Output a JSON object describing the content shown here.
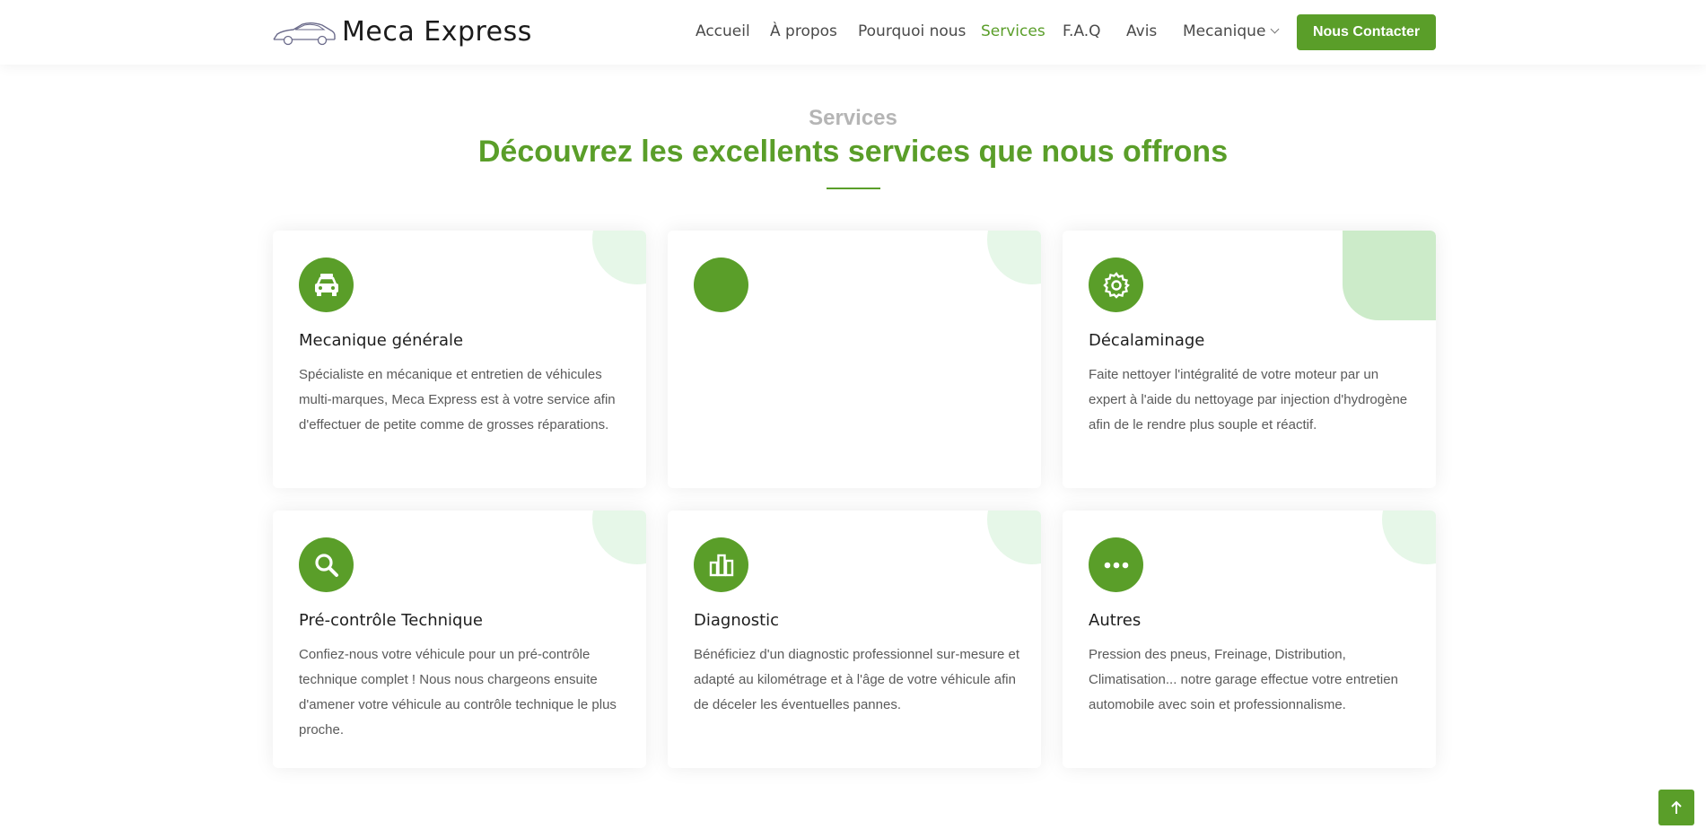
{
  "header": {
    "brand": "Meca Express",
    "logo_icon": "car-outline-icon",
    "nav": [
      {
        "label": "Accueil",
        "active": false
      },
      {
        "label": "À propos",
        "active": false
      },
      {
        "label": "Pourquoi nous",
        "active": false
      },
      {
        "label": "Services",
        "active": true
      },
      {
        "label": "F.A.Q",
        "active": false
      },
      {
        "label": "Avis",
        "active": false
      },
      {
        "label": "Mecanique",
        "active": false,
        "dropdown": true
      }
    ],
    "cta_label": "Nous Contacter"
  },
  "section": {
    "label": "Services",
    "title": "Découvrez les excellents services que nous offrons"
  },
  "cards": [
    {
      "icon": "car-icon",
      "title": "Mecanique générale",
      "description": "Spécialiste en mécanique et entretien de véhicules multi-marques, Meca Express est à votre service afin d'effectuer de petite comme de grosses réparations."
    },
    {
      "icon": "",
      "title": "",
      "description": ""
    },
    {
      "icon": "gear-icon",
      "title": "Décalaminage",
      "description": "Faite nettoyer l'intégralité de votre moteur par un expert à l'aide du nettoyage par injection d'hydrogène afin de le rendre plus souple et réactif."
    },
    {
      "icon": "search-icon",
      "title": "Pré-contrôle Technique",
      "description": "Confiez-nous votre véhicule pour un pré-contrôle technique complet ! Nous nous chargeons ensuite d'amener votre véhicule au contrôle technique le plus proche."
    },
    {
      "icon": "bar-chart-icon",
      "title": "Diagnostic",
      "description": "Bénéficiez d'un diagnostic professionnel sur-mesure et adapté au kilométrage et à l'âge de votre véhicule afin de déceler les éventuelles pannes."
    },
    {
      "icon": "more-dots-icon",
      "title": "Autres",
      "description": "Pression des pneus, Freinage, Distribution, Climatisation... notre garage effectue votre entretien automobile avec soin et professionnalisme."
    }
  ],
  "colors": {
    "accent": "#5a9e29",
    "deco_light": "#e6f7e8",
    "deco_active": "#ccebc9"
  },
  "scroll_top_icon": "arrow-up-icon"
}
